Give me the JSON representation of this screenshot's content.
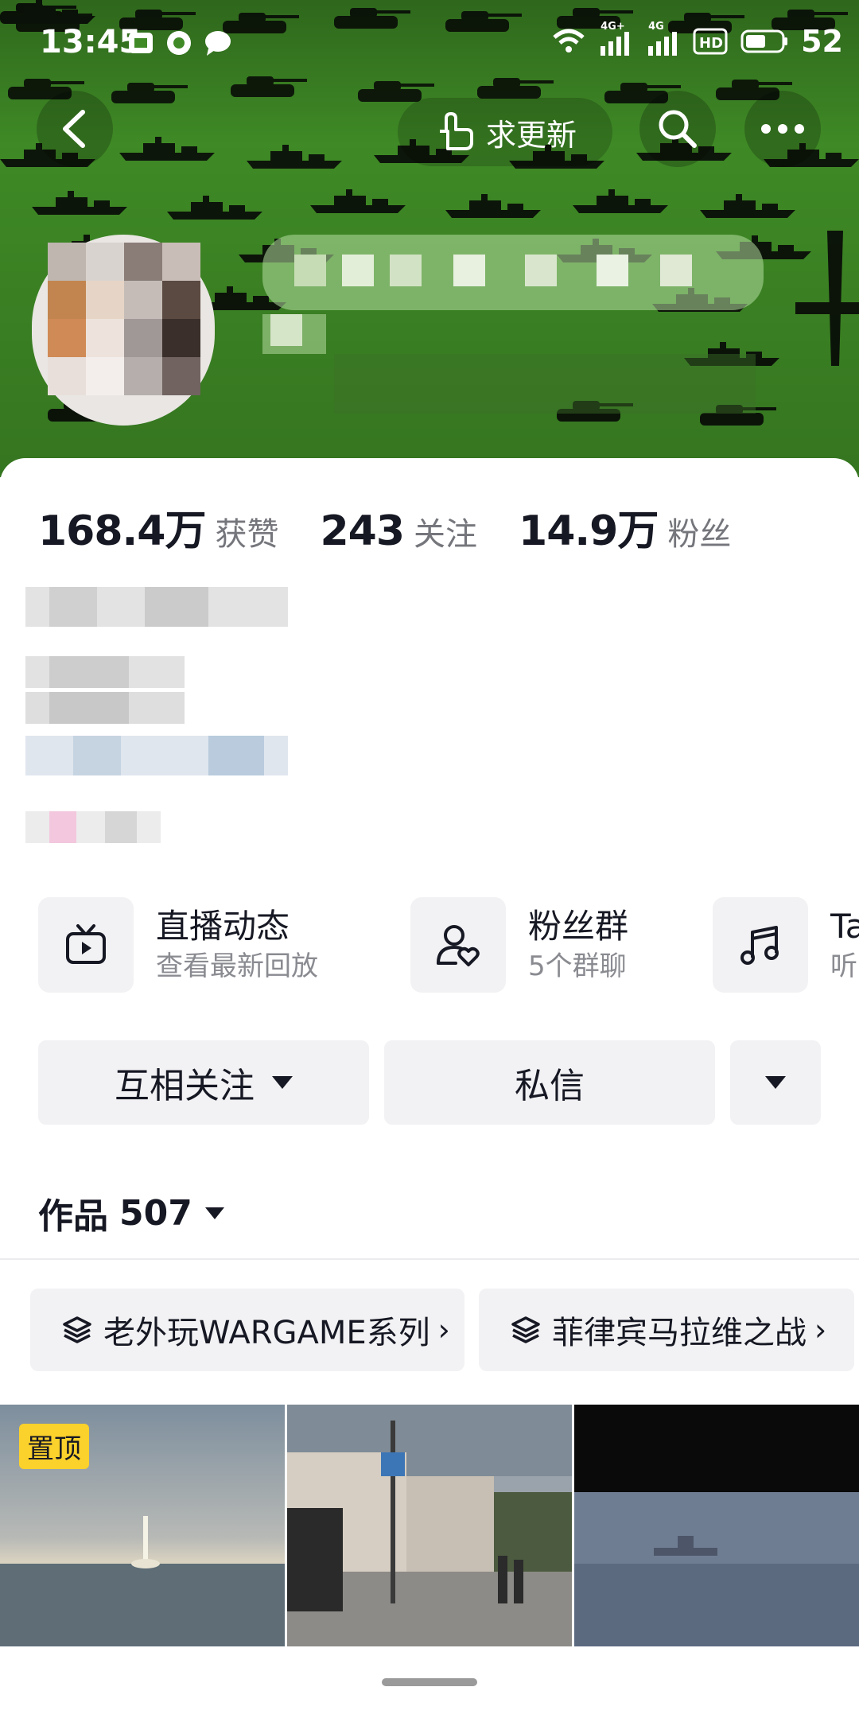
{
  "status_bar": {
    "time": "13:45",
    "network_1": "4G+",
    "network_2": "4G",
    "battery": "52"
  },
  "header": {
    "update_label": "求更新",
    "back_icon": "chevron-left-icon",
    "search_icon": "search-icon",
    "more_icon": "more-dots-icon"
  },
  "stats": [
    {
      "value": "168.4万",
      "label": "获赞"
    },
    {
      "value": "243",
      "label": "关注"
    },
    {
      "value": "14.9万",
      "label": "粉丝"
    }
  ],
  "features": [
    {
      "title": "直播动态",
      "subtitle": "查看最新回放",
      "icon": "tv-icon"
    },
    {
      "title": "粉丝群",
      "subtitle": "5个群聊",
      "icon": "user-heart-icon"
    },
    {
      "title": "Ta",
      "subtitle": "听",
      "icon": "music-note-icon"
    }
  ],
  "actions": {
    "follow_label": "互相关注",
    "message_label": "私信"
  },
  "works": {
    "label": "作品",
    "count": "507"
  },
  "collections": [
    {
      "label": "老外玩WARGAME系列"
    },
    {
      "label": "菲律宾马拉维之战"
    }
  ],
  "thumbnails": [
    {
      "badge": "置顶"
    },
    {
      "badge": ""
    },
    {
      "badge": ""
    }
  ],
  "colors": {
    "banner_green": "#3f8a26",
    "pin_badge": "#fbd12b",
    "surface_gray": "#f2f2f4"
  }
}
